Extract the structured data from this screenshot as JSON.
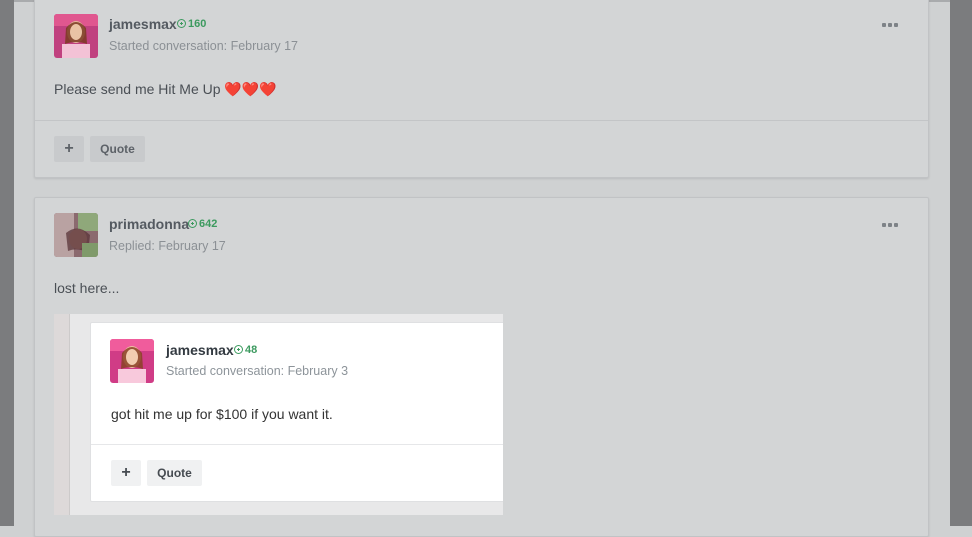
{
  "posts": [
    {
      "author": "jamesmax",
      "reputation": "160",
      "meta": "Started conversation: February 17",
      "body": "Please send me Hit Me Up ❤️❤️❤️",
      "actions": {
        "plus": "+",
        "quote": "Quote"
      }
    },
    {
      "author": "primadonna",
      "reputation": "642",
      "meta": "Replied: February 17",
      "body": "lost here...",
      "embed": {
        "author": "jamesmax",
        "reputation": "48",
        "meta": "Started conversation: February 3",
        "body": "got hit me up for $100 if you want it.",
        "actions": {
          "plus": "+",
          "quote": "Quote"
        }
      }
    }
  ],
  "icons": {
    "reputation": "plus-circle-icon",
    "more": "more-options-icon",
    "plus": "plus-icon"
  },
  "colors": {
    "reputation": "#3c9a5f",
    "background": "#cfd1d2",
    "card": "#ffffff"
  }
}
